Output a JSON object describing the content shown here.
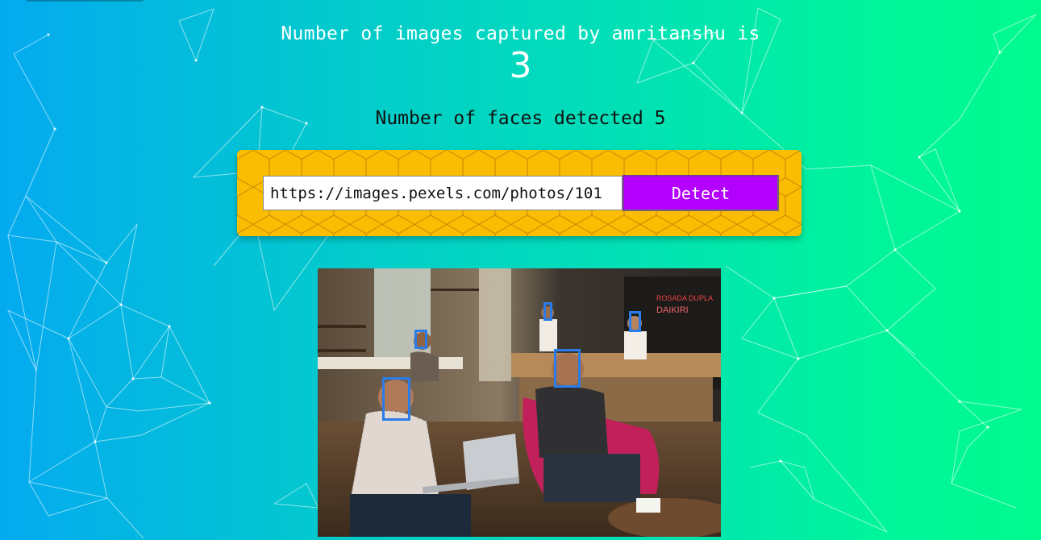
{
  "header": {
    "captured_text": "Number of images captured by amritanshu is",
    "captured_count": "3",
    "faces_text": "Number of faces detected 5"
  },
  "form": {
    "url_value": "https://images.pexels.com/photos/101",
    "detect_label": "Detect"
  },
  "result": {
    "faces_detected": 5
  },
  "colors": {
    "panel": "#fbbd02",
    "button": "#b400ff",
    "face_box": "#2b7ce8"
  }
}
